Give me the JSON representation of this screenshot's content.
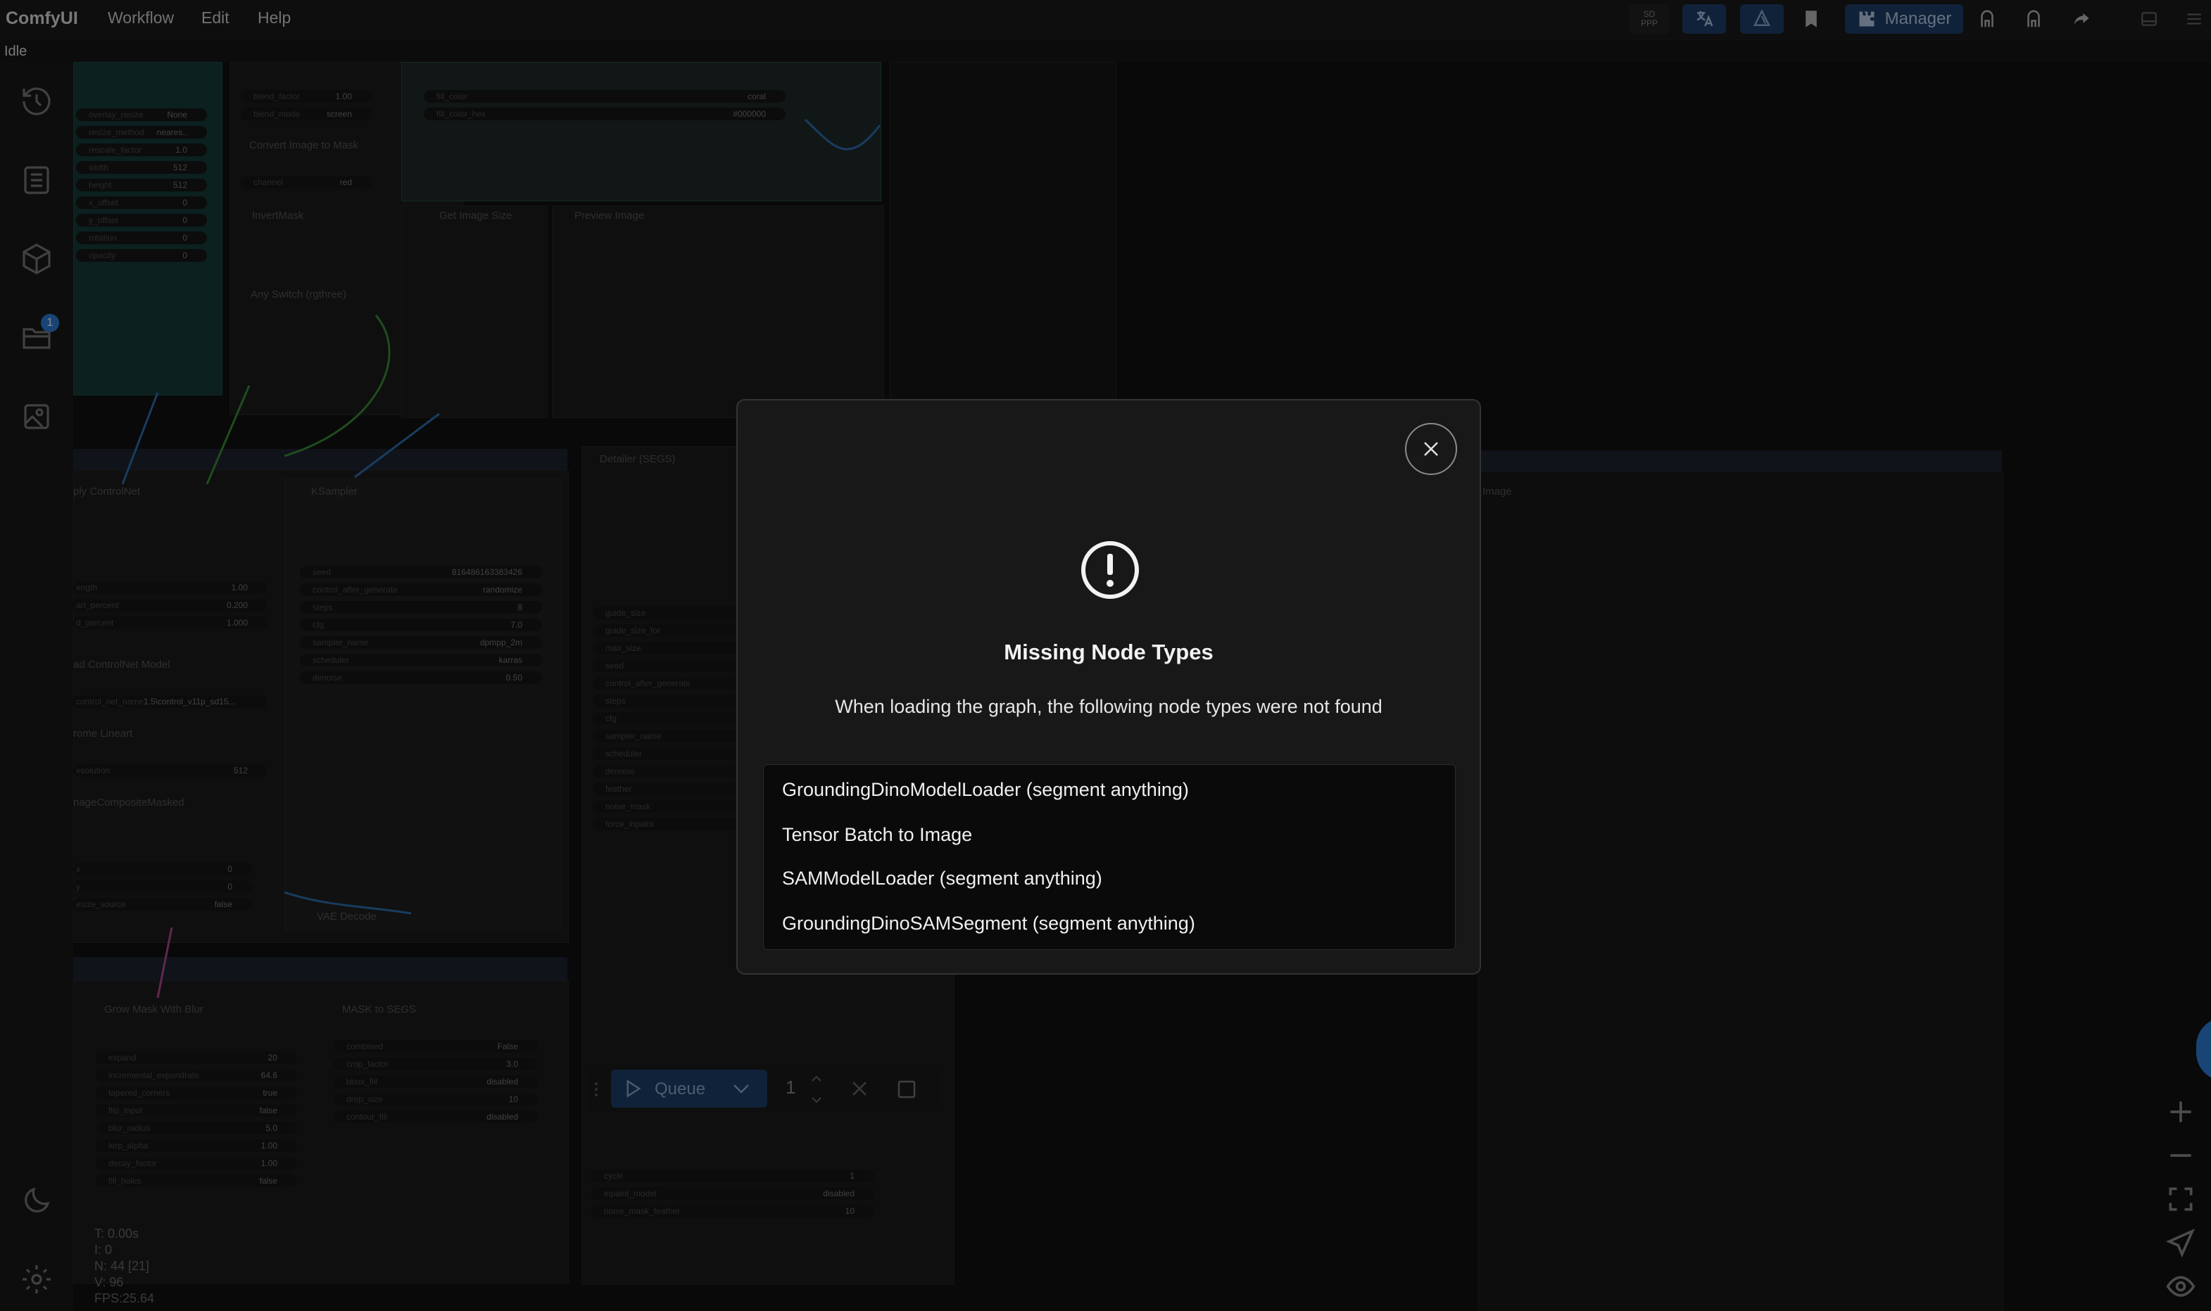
{
  "app": {
    "title": "ComfyUI"
  },
  "menu": {
    "workflow": "Workflow",
    "edit": "Edit",
    "help": "Help"
  },
  "toolbar": {
    "sd_ppp_line1": "SD",
    "sd_ppp_line2": "PPP",
    "manager_label": "Manager",
    "icons": [
      "translate-icon",
      "model-icon",
      "bookmark-icon",
      "puzzle-icon",
      "user-icon",
      "user-alt-icon",
      "share-icon",
      "panel-icon",
      "menu-icon"
    ]
  },
  "status": {
    "idle": "Idle"
  },
  "sidebar": {
    "items": [
      "history-icon",
      "queue-list-icon",
      "models-cube-icon",
      "workflows-folder-icon",
      "gallery-icon"
    ],
    "workflow_badge": "1",
    "bottom": [
      "theme-moon-icon",
      "settings-gear-icon"
    ]
  },
  "canvas": {
    "nodes": {
      "convert_image_to_mask": "Convert Image to Mask",
      "invert_mask": "InvertMask",
      "get_image_size": "Get Image Size",
      "preview_image": "Preview Image",
      "any_switch": "Any Switch (rgthree)",
      "apply_controlnet": "ply ControlNet",
      "ksampler": "KSampler",
      "detailer": "Detailer (SEGS)",
      "load_controlnet": "ad ControlNet Model",
      "lineart": "rome Lineart",
      "image_composite": "nageCompositeMasked",
      "vae_decode": "VAE Decode",
      "grow_mask": "Grow Mask With Blur",
      "mask_to_segs": "MASK to SEGS",
      "image_right": "Image"
    },
    "widgets_left": [
      {
        "k": "overlay_resize",
        "v": "None"
      },
      {
        "k": "resize_method",
        "v": "neares.."
      },
      {
        "k": "rescale_factor",
        "v": "1.0"
      },
      {
        "k": "width",
        "v": "512"
      },
      {
        "k": "height",
        "v": "512"
      },
      {
        "k": "x_offset",
        "v": "0"
      },
      {
        "k": "y_offset",
        "v": "0"
      },
      {
        "k": "rotation",
        "v": "0"
      },
      {
        "k": "opacity",
        "v": "0"
      }
    ],
    "widgets_blend": [
      {
        "k": "blend_factor",
        "v": "1.00"
      },
      {
        "k": "blend_mode",
        "v": "screen"
      }
    ],
    "widget_channel": {
      "k": "channel",
      "v": "red"
    },
    "widgets_fill": [
      {
        "k": "fill_color",
        "v": "coral"
      },
      {
        "k": "fill_color_hex",
        "v": "#000000"
      }
    ],
    "widgets_ksampler": [
      {
        "k": "seed",
        "v": "816486163383426"
      },
      {
        "k": "control_after_generate",
        "v": "randomize"
      },
      {
        "k": "steps",
        "v": "8"
      },
      {
        "k": "cfg",
        "v": "7.0"
      },
      {
        "k": "sampler_name",
        "v": "dpmpp_2m"
      },
      {
        "k": "scheduler",
        "v": "karras"
      },
      {
        "k": "denoise",
        "v": "0.50"
      }
    ],
    "widgets_controlnet": [
      {
        "k": "ength",
        "v": "1.00"
      },
      {
        "k": "art_percent",
        "v": "0.200"
      },
      {
        "k": "d_percent",
        "v": "1.000"
      }
    ],
    "controlnet_name": {
      "k": "control_net_name",
      "v": "1.5\\control_v11p_sd15..."
    },
    "resolution": {
      "k": "esolution",
      "v": "512"
    },
    "widgets_composite": [
      {
        "k": "x",
        "v": "0"
      },
      {
        "k": "y",
        "v": "0"
      },
      {
        "k": "esize_source",
        "v": "false"
      }
    ],
    "widgets_grow": [
      {
        "k": "expand",
        "v": "20"
      },
      {
        "k": "incremental_expandrate",
        "v": "64.6"
      },
      {
        "k": "tapered_corners",
        "v": "true"
      },
      {
        "k": "flip_input",
        "v": "false"
      },
      {
        "k": "blur_radius",
        "v": "5.0"
      },
      {
        "k": "lerp_alpha",
        "v": "1.00"
      },
      {
        "k": "decay_factor",
        "v": "1.00"
      },
      {
        "k": "fill_holes",
        "v": "false"
      }
    ],
    "widgets_segs": [
      {
        "k": "combined",
        "v": "False"
      },
      {
        "k": "crop_factor",
        "v": "3.0"
      },
      {
        "k": "bbox_fill",
        "v": "disabled"
      },
      {
        "k": "drop_size",
        "v": "10"
      },
      {
        "k": "contour_fill",
        "v": "disabled"
      }
    ],
    "widgets_detailer": [
      {
        "k": "guide_size",
        "v": ""
      },
      {
        "k": "guide_size_for",
        "v": ""
      },
      {
        "k": "max_size",
        "v": ""
      },
      {
        "k": "seed",
        "v": ""
      },
      {
        "k": "control_after_generate",
        "v": ""
      },
      {
        "k": "steps",
        "v": ""
      },
      {
        "k": "cfg",
        "v": ""
      },
      {
        "k": "sampler_name",
        "v": ""
      },
      {
        "k": "scheduler",
        "v": ""
      },
      {
        "k": "denoise",
        "v": ""
      },
      {
        "k": "feather",
        "v": ""
      },
      {
        "k": "noise_mask",
        "v": ""
      },
      {
        "k": "force_inpaint",
        "v": ""
      }
    ],
    "widgets_detailer_bottom": [
      {
        "k": "cycle",
        "v": "1"
      },
      {
        "k": "inpaint_model",
        "v": "disabled"
      },
      {
        "k": "noise_mask_feather",
        "v": "10"
      }
    ]
  },
  "stats": {
    "t": "T: 0.00s",
    "i": "I: 0",
    "n": "N: 44 [21]",
    "v": "V: 96",
    "fps": "FPS:25.64"
  },
  "queue": {
    "label": "Queue",
    "count": "1"
  },
  "dialog": {
    "title": "Missing Node Types",
    "message": "When loading the graph, the following node types were not found",
    "missing": [
      "GroundingDinoModelLoader (segment anything)",
      "Tensor Batch to Image",
      "SAMModelLoader (segment anything)",
      "GroundingDinoSAMSegment (segment anything)"
    ]
  },
  "canvas_controls": [
    "zoom-in-icon",
    "zoom-out-icon",
    "fit-view-icon",
    "pointer-icon",
    "eye-icon"
  ],
  "colors": {
    "accent": "#2e7fd8",
    "queue_bg": "#1e3e68",
    "dialog_bg": "#181818"
  }
}
